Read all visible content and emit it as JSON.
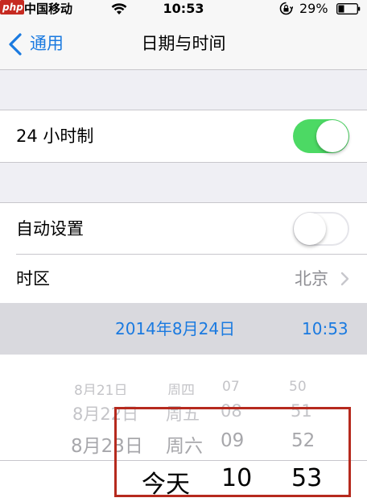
{
  "status_bar": {
    "carrier": "中国移动",
    "time": "10:53",
    "battery_percent": "29%",
    "watermark": "php"
  },
  "nav": {
    "back_label": "通用",
    "title": "日期与时间"
  },
  "settings": {
    "clock_24h": {
      "label": "24 小时制",
      "on": true
    },
    "auto_set": {
      "label": "自动设置",
      "on": false
    },
    "timezone": {
      "label": "时区",
      "value": "北京"
    }
  },
  "current": {
    "date": "2014年8月24日",
    "time": "10:53"
  },
  "picker": {
    "rows": [
      {
        "date": "8月21日",
        "weekday": "周四",
        "hour": "07",
        "minute": "50"
      },
      {
        "date": "8月22日",
        "weekday": "周五",
        "hour": "08",
        "minute": "51"
      },
      {
        "date": "8月23日",
        "weekday": "周六",
        "hour": "09",
        "minute": "52"
      }
    ],
    "selected": {
      "date": "今天",
      "hour": "10",
      "minute": "53"
    }
  },
  "colors": {
    "accent": "#1a7ae0",
    "toggle_on": "#4cd964",
    "highlight": "#b62a1e"
  }
}
